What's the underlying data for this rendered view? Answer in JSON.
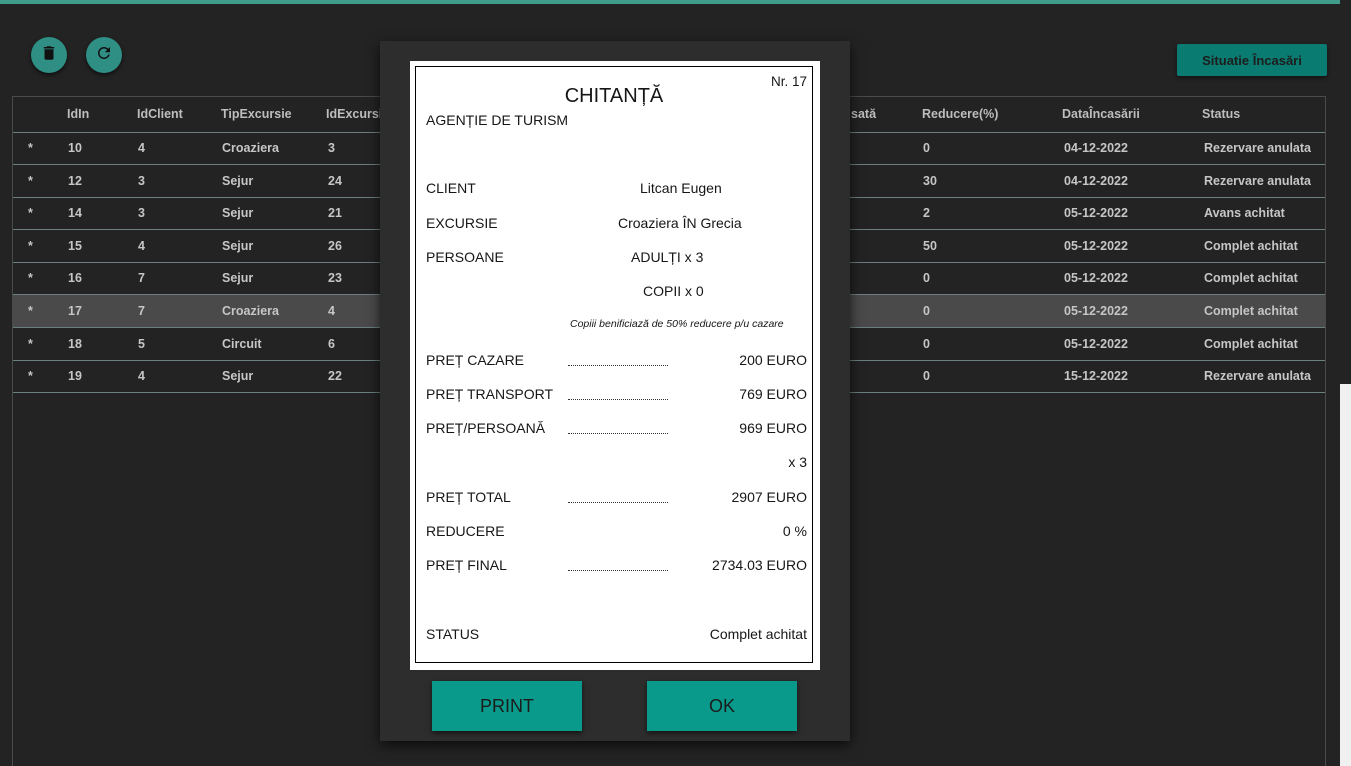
{
  "toolbar": {
    "delete_icon": "trash-icon",
    "refresh_icon": "refresh-icon",
    "situatie_label": "Situatie Încasări"
  },
  "table": {
    "columns": [
      "IdIn",
      "IdClient",
      "TipExcursie",
      "IdExcursi",
      "sată",
      "Reducere(%)",
      "DataÎncasării",
      "Status"
    ],
    "rows": [
      {
        "marker": "*",
        "idin": "10",
        "idclient": "4",
        "tip": "Croaziera",
        "idexc": "3",
        "reducere": "0",
        "data": "04-12-2022",
        "status": "Rezervare anulata"
      },
      {
        "marker": "*",
        "idin": "12",
        "idclient": "3",
        "tip": "Sejur",
        "idexc": "24",
        "reducere": "30",
        "data": "04-12-2022",
        "status": "Rezervare anulata"
      },
      {
        "marker": "*",
        "idin": "14",
        "idclient": "3",
        "tip": "Sejur",
        "idexc": "21",
        "reducere": "2",
        "data": "05-12-2022",
        "status": "Avans achitat"
      },
      {
        "marker": "*",
        "idin": "15",
        "idclient": "4",
        "tip": "Sejur",
        "idexc": "26",
        "reducere": "50",
        "data": "05-12-2022",
        "status": "Complet achitat"
      },
      {
        "marker": "*",
        "idin": "16",
        "idclient": "7",
        "tip": "Sejur",
        "idexc": "23",
        "reducere": "0",
        "data": "05-12-2022",
        "status": "Complet achitat"
      },
      {
        "marker": "*",
        "idin": "17",
        "idclient": "7",
        "tip": "Croaziera",
        "idexc": "4",
        "reducere": "0",
        "data": "05-12-2022",
        "status": "Complet achitat"
      },
      {
        "marker": "*",
        "idin": "18",
        "idclient": "5",
        "tip": "Circuit",
        "idexc": "6",
        "reducere": "0",
        "data": "05-12-2022",
        "status": "Complet achitat"
      },
      {
        "marker": "*",
        "idin": "19",
        "idclient": "4",
        "tip": "Sejur",
        "idexc": "22",
        "reducere": "0",
        "data": "15-12-2022",
        "status": "Rezervare anulata"
      }
    ]
  },
  "receipt": {
    "title": "CHITANȚĂ",
    "nr": "Nr. 17",
    "agency": "AGENȚIE DE TURISM",
    "client_label": "CLIENT",
    "client_value": "Litcan Eugen",
    "excursie_label": "EXCURSIE",
    "excursie_value": "Croaziera ÎN Grecia",
    "persoane_label": "PERSOANE",
    "adulti_value": "ADULȚI x 3",
    "copii_value": "COPII x 0",
    "note": "Copiii benificiază de 50% reducere p/u cazare",
    "pret_cazare_label": "PREȚ CAZARE",
    "pret_cazare_value": "200 EURO",
    "pret_transport_label": "PREȚ TRANSPORT",
    "pret_transport_value": "769 EURO",
    "pret_persoana_label": "PREȚ/PERSOANĂ",
    "pret_persoana_value": "969 EURO",
    "multiplier": "x  3",
    "pret_total_label": "PREȚ TOTAL",
    "pret_total_value": "2907 EURO",
    "reducere_label": "REDUCERE",
    "reducere_value": "0 %",
    "pret_final_label": "PREȚ FINAL",
    "pret_final_value": "2734.03 EURO",
    "status_label": "STATUS",
    "status_value": "Complet achitat"
  },
  "modal": {
    "print_label": "PRINT",
    "ok_label": "OK"
  },
  "colors": {
    "accent": "#0a9a8b",
    "topbar": "#3f9b8a",
    "background": "#232323"
  }
}
